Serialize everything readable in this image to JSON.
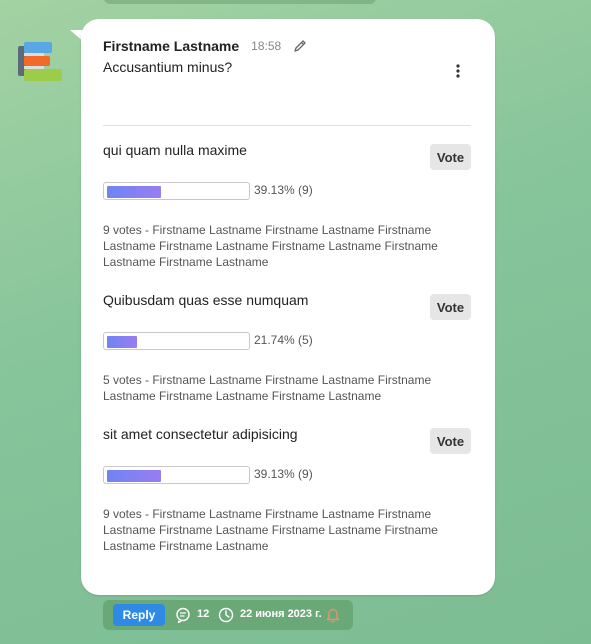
{
  "message": {
    "author": "Firstname Lastname",
    "time": "18:58",
    "question": "Accusantium minus?"
  },
  "options": [
    {
      "title": "qui quam nulla maxime",
      "vote_label": "Vote",
      "percent": 39.13,
      "result_label": "39.13% (9)",
      "voters_text": "9 votes - Firstname Lastname Firstname Lastname Firstname Lastname Firstname Lastname Firstname Lastname Firstname Lastname Firstname Lastname"
    },
    {
      "title": "Quibusdam quas esse numquam",
      "vote_label": "Vote",
      "percent": 21.74,
      "result_label": "21.74% (5)",
      "voters_text": "5 votes - Firstname Lastname Firstname Lastname Firstname Lastname Firstname Lastname Firstname Lastname"
    },
    {
      "title": "sit amet consectetur adipisicing",
      "vote_label": "Vote",
      "percent": 39.13,
      "result_label": "39.13% (9)",
      "voters_text": "9 votes - Firstname Lastname Firstname Lastname Firstname Lastname Firstname Lastname Firstname Lastname Firstname Lastname Firstname Lastname"
    }
  ],
  "footer": {
    "reply_label": "Reply",
    "comments_count": "12",
    "date": "22 июня 2023 г."
  },
  "icons": {
    "edit": "pencil-icon",
    "more": "more-vertical-icon",
    "comments": "comment-icon",
    "date": "clock-icon",
    "notify": "bell-icon"
  },
  "colors": {
    "accent": "#2f8ae6",
    "bar_start": "#6f85f2",
    "bar_end": "#9a7cf1",
    "bell": "#e8926b"
  }
}
